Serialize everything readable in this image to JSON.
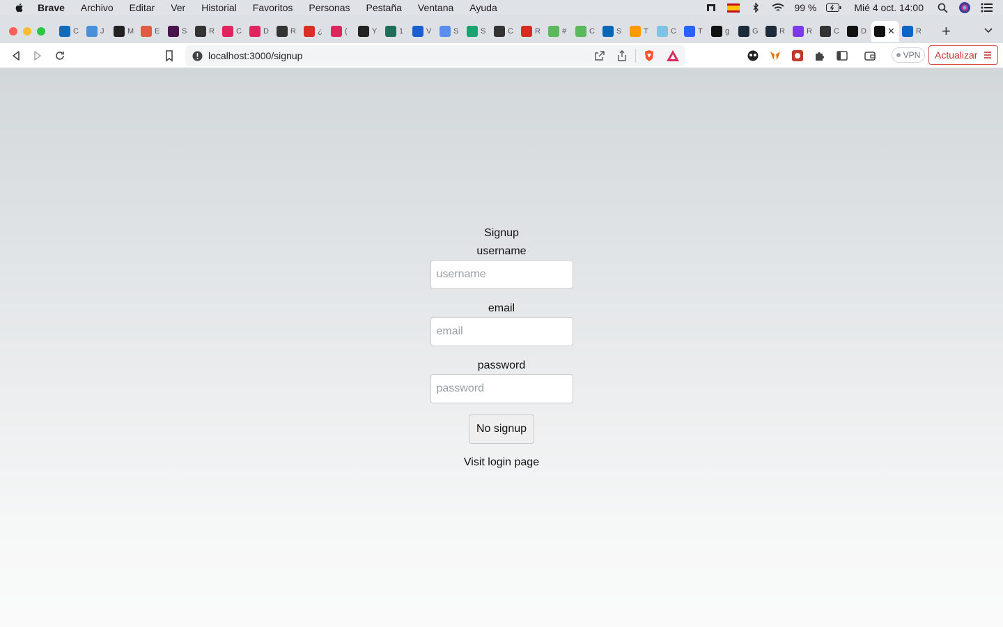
{
  "menubar": {
    "app": "Brave",
    "items": [
      "Archivo",
      "Editar",
      "Ver",
      "Historial",
      "Favoritos",
      "Personas",
      "Pestaña",
      "Ventana",
      "Ayuda"
    ],
    "battery": "99 %",
    "datetime": "Mié 4 oct.  14:00"
  },
  "tabs": [
    {
      "icon": "outlook-icon",
      "color": "#0f6cbd",
      "title": "C"
    },
    {
      "icon": "page-icon",
      "color": "#4a90d9",
      "title": "J"
    },
    {
      "icon": "github-icon",
      "color": "#222222",
      "title": "M"
    },
    {
      "icon": "app-icon",
      "color": "#e05d44",
      "title": "E"
    },
    {
      "icon": "slack-icon",
      "color": "#4a154b",
      "title": "S"
    },
    {
      "icon": "cursor-icon",
      "color": "#333333",
      "title": "R"
    },
    {
      "icon": "red-circle-icon",
      "color": "#e0245e",
      "title": "C"
    },
    {
      "icon": "red-circle-icon",
      "color": "#e0245e",
      "title": "D"
    },
    {
      "icon": "cursor-icon",
      "color": "#333333",
      "title": "R"
    },
    {
      "icon": "gmail-icon",
      "color": "#d93025",
      "title": "¿"
    },
    {
      "icon": "app-icon",
      "color": "#e0245e",
      "title": "("
    },
    {
      "icon": "github-icon",
      "color": "#222222",
      "title": "Y"
    },
    {
      "icon": "app-icon",
      "color": "#1e6e5a",
      "title": "1"
    },
    {
      "icon": "check-icon",
      "color": "#1a5fd1",
      "title": "V"
    },
    {
      "icon": "circle-icon",
      "color": "#5b8def",
      "title": "S"
    },
    {
      "icon": "app-icon",
      "color": "#1aa36f",
      "title": "S"
    },
    {
      "icon": "app-icon",
      "color": "#333333",
      "title": "C"
    },
    {
      "icon": "pin-icon",
      "color": "#d62d20",
      "title": "R"
    },
    {
      "icon": "app-icon",
      "color": "#5cb85c",
      "title": "#"
    },
    {
      "icon": "app-icon",
      "color": "#5cb85c",
      "title": "C"
    },
    {
      "icon": "app-icon",
      "color": "#0067b8",
      "title": "S"
    },
    {
      "icon": "amazon-icon",
      "color": "#ff9900",
      "title": "T"
    },
    {
      "icon": "app-icon",
      "color": "#7bc4e8",
      "title": "C"
    },
    {
      "icon": "app-icon",
      "color": "#2962ff",
      "title": "T"
    },
    {
      "icon": "app-icon",
      "color": "#111111",
      "title": "g"
    },
    {
      "icon": "app-icon",
      "color": "#1c2b3a",
      "title": "G"
    },
    {
      "icon": "app-icon",
      "color": "#1c2b3a",
      "title": "R"
    },
    {
      "icon": "app-icon",
      "color": "#7c3aed",
      "title": "R"
    },
    {
      "icon": "grid-icon",
      "color": "#333333",
      "title": "C"
    },
    {
      "icon": "app-icon",
      "color": "#111111",
      "title": "D"
    },
    {
      "icon": "app-icon",
      "color": "#111111",
      "title": "",
      "active": true
    },
    {
      "icon": "linkedin-icon",
      "color": "#0a66c2",
      "title": "R"
    }
  ],
  "toolbar": {
    "url": "localhost:3000/signup",
    "vpn_label": "VPN",
    "update_label": "Actualizar"
  },
  "form": {
    "title": "Signup",
    "username_label": "username",
    "username_placeholder": "username",
    "email_label": "email",
    "email_placeholder": "email",
    "password_label": "password",
    "password_placeholder": "password",
    "submit_label": "No signup",
    "login_link": "Visit login page"
  },
  "colors": {
    "page_gradient_top": "#d2d7da",
    "page_gradient_bottom": "#fafafa",
    "update_accent": "#c53030"
  }
}
